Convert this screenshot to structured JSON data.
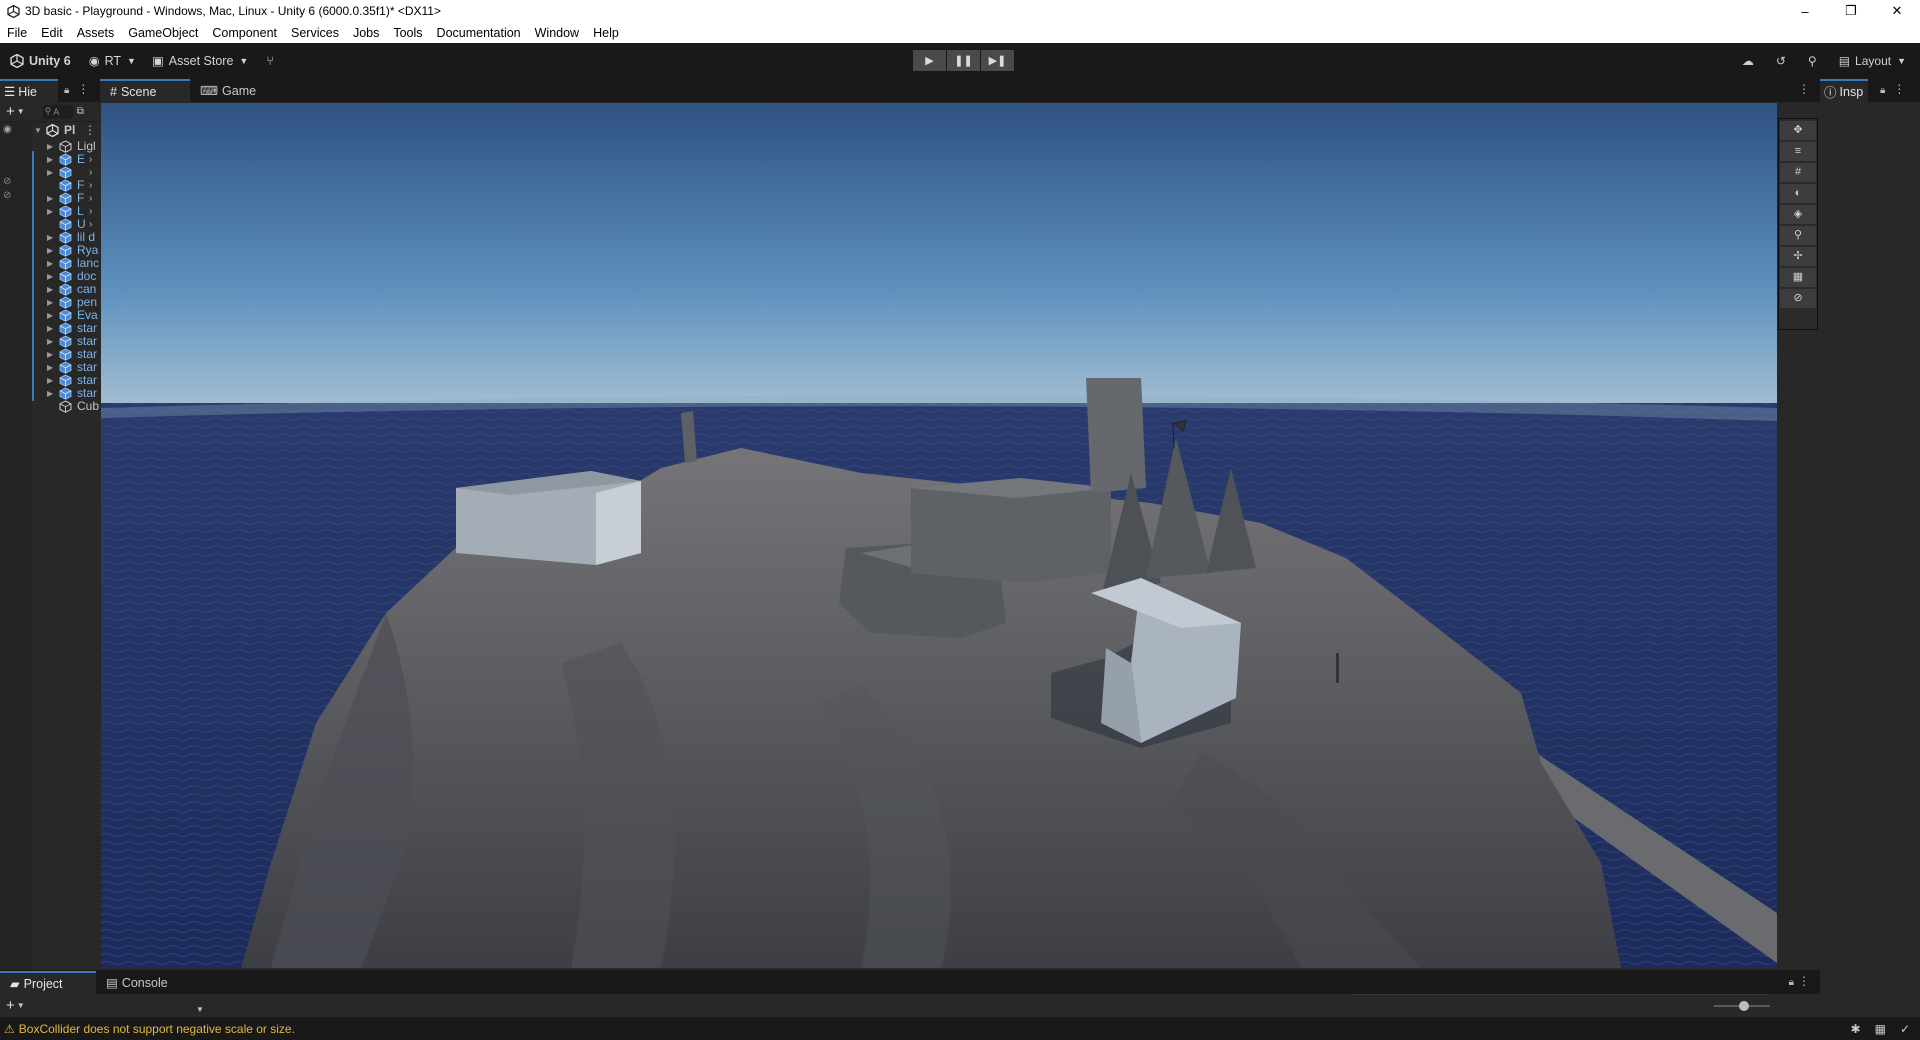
{
  "window": {
    "title": "3D basic - Playground - Windows, Mac, Linux - Unity 6 (6000.0.35f1)* <DX11>",
    "minimize": "–",
    "restore": "❐",
    "close": "✕"
  },
  "menu": [
    "File",
    "Edit",
    "Assets",
    "GameObject",
    "Component",
    "Services",
    "Jobs",
    "Tools",
    "Documentation",
    "Window",
    "Help"
  ],
  "toolbar": {
    "account": "Unity 6",
    "user": "RT",
    "asset_store": "Asset Store",
    "layout": "Layout"
  },
  "hierarchy": {
    "tab_label": "Hie",
    "search_placeholder": "A",
    "scene_name": "Pl",
    "rows": [
      {
        "label": "Ligl",
        "plain": true,
        "arrow": true,
        "more": false
      },
      {
        "label": "E",
        "plain": false,
        "arrow": true,
        "more": true
      },
      {
        "label": "",
        "plain": false,
        "arrow": true,
        "more": true
      },
      {
        "label": "F",
        "plain": false,
        "arrow": false,
        "more": true
      },
      {
        "label": "F",
        "plain": false,
        "arrow": true,
        "more": true
      },
      {
        "label": "L",
        "plain": false,
        "arrow": true,
        "more": true
      },
      {
        "label": "U",
        "plain": false,
        "arrow": false,
        "more": true
      },
      {
        "label": "lil d",
        "plain": false,
        "arrow": true,
        "more": false
      },
      {
        "label": "Rya",
        "plain": false,
        "arrow": true,
        "more": false
      },
      {
        "label": "lanc",
        "plain": false,
        "arrow": true,
        "more": false
      },
      {
        "label": "doc",
        "plain": false,
        "arrow": true,
        "more": false
      },
      {
        "label": "can",
        "plain": false,
        "arrow": true,
        "more": false
      },
      {
        "label": "pen",
        "plain": false,
        "arrow": true,
        "more": false
      },
      {
        "label": "Eva",
        "plain": false,
        "arrow": true,
        "more": false
      },
      {
        "label": "star",
        "plain": false,
        "arrow": true,
        "more": false
      },
      {
        "label": "star",
        "plain": false,
        "arrow": true,
        "more": false
      },
      {
        "label": "star",
        "plain": false,
        "arrow": true,
        "more": false
      },
      {
        "label": "star",
        "plain": false,
        "arrow": true,
        "more": false
      },
      {
        "label": "star",
        "plain": false,
        "arrow": true,
        "more": false
      },
      {
        "label": "star",
        "plain": false,
        "arrow": true,
        "more": false
      },
      {
        "label": "Cub",
        "plain": true,
        "arrow": false,
        "more": false
      }
    ]
  },
  "scene_tabs": {
    "scene": "Scene",
    "game": "Game"
  },
  "inspector": {
    "tab_label": "Insp"
  },
  "bottom_tabs": {
    "project": "Project",
    "console": "Console"
  },
  "status": {
    "message": "BoxCollider does not support negative scale or size.",
    "zoom_level": 0.55
  },
  "colors": {
    "accent": "#3a79bb",
    "warning": "#e2b93b",
    "ocean": "#23346a",
    "sky_top": "#355a88",
    "terrain": "#6c6c6e"
  }
}
